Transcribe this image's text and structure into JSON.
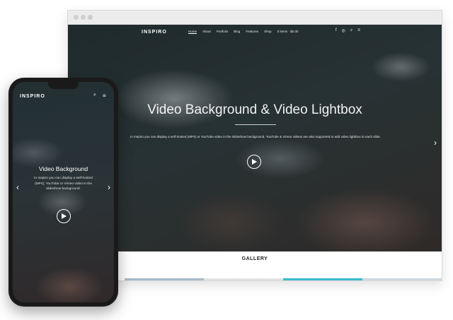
{
  "desktop": {
    "brand": "INSPIRO",
    "nav": [
      "Home",
      "About",
      "Portfolio",
      "Blog",
      "Features",
      "Shop",
      "0 items · $0.00"
    ],
    "nav_icons": [
      "f",
      "◎",
      "⌕",
      "≡"
    ],
    "hero": {
      "title": "Video Background & Video Lightbox",
      "description": "In Inspiro you can display a self-hosted (MP4) or YouTube video in the slideshow background. YouTube & Vimeo videos are also supported to add video lightbox to each slide."
    },
    "gallery_title": "GALLERY"
  },
  "mobile": {
    "brand": "INSPIRO",
    "hero": {
      "title": "Video Background",
      "description": "In Inspiro you can display a self-hosted (MP4), YouTube or Vimeo video in the slideshow background."
    }
  },
  "icons": {
    "play": "play-icon",
    "arrow_right": "chevron-right-icon",
    "arrow_left": "chevron-left-icon",
    "search": "search-icon",
    "menu": "menu-icon"
  }
}
